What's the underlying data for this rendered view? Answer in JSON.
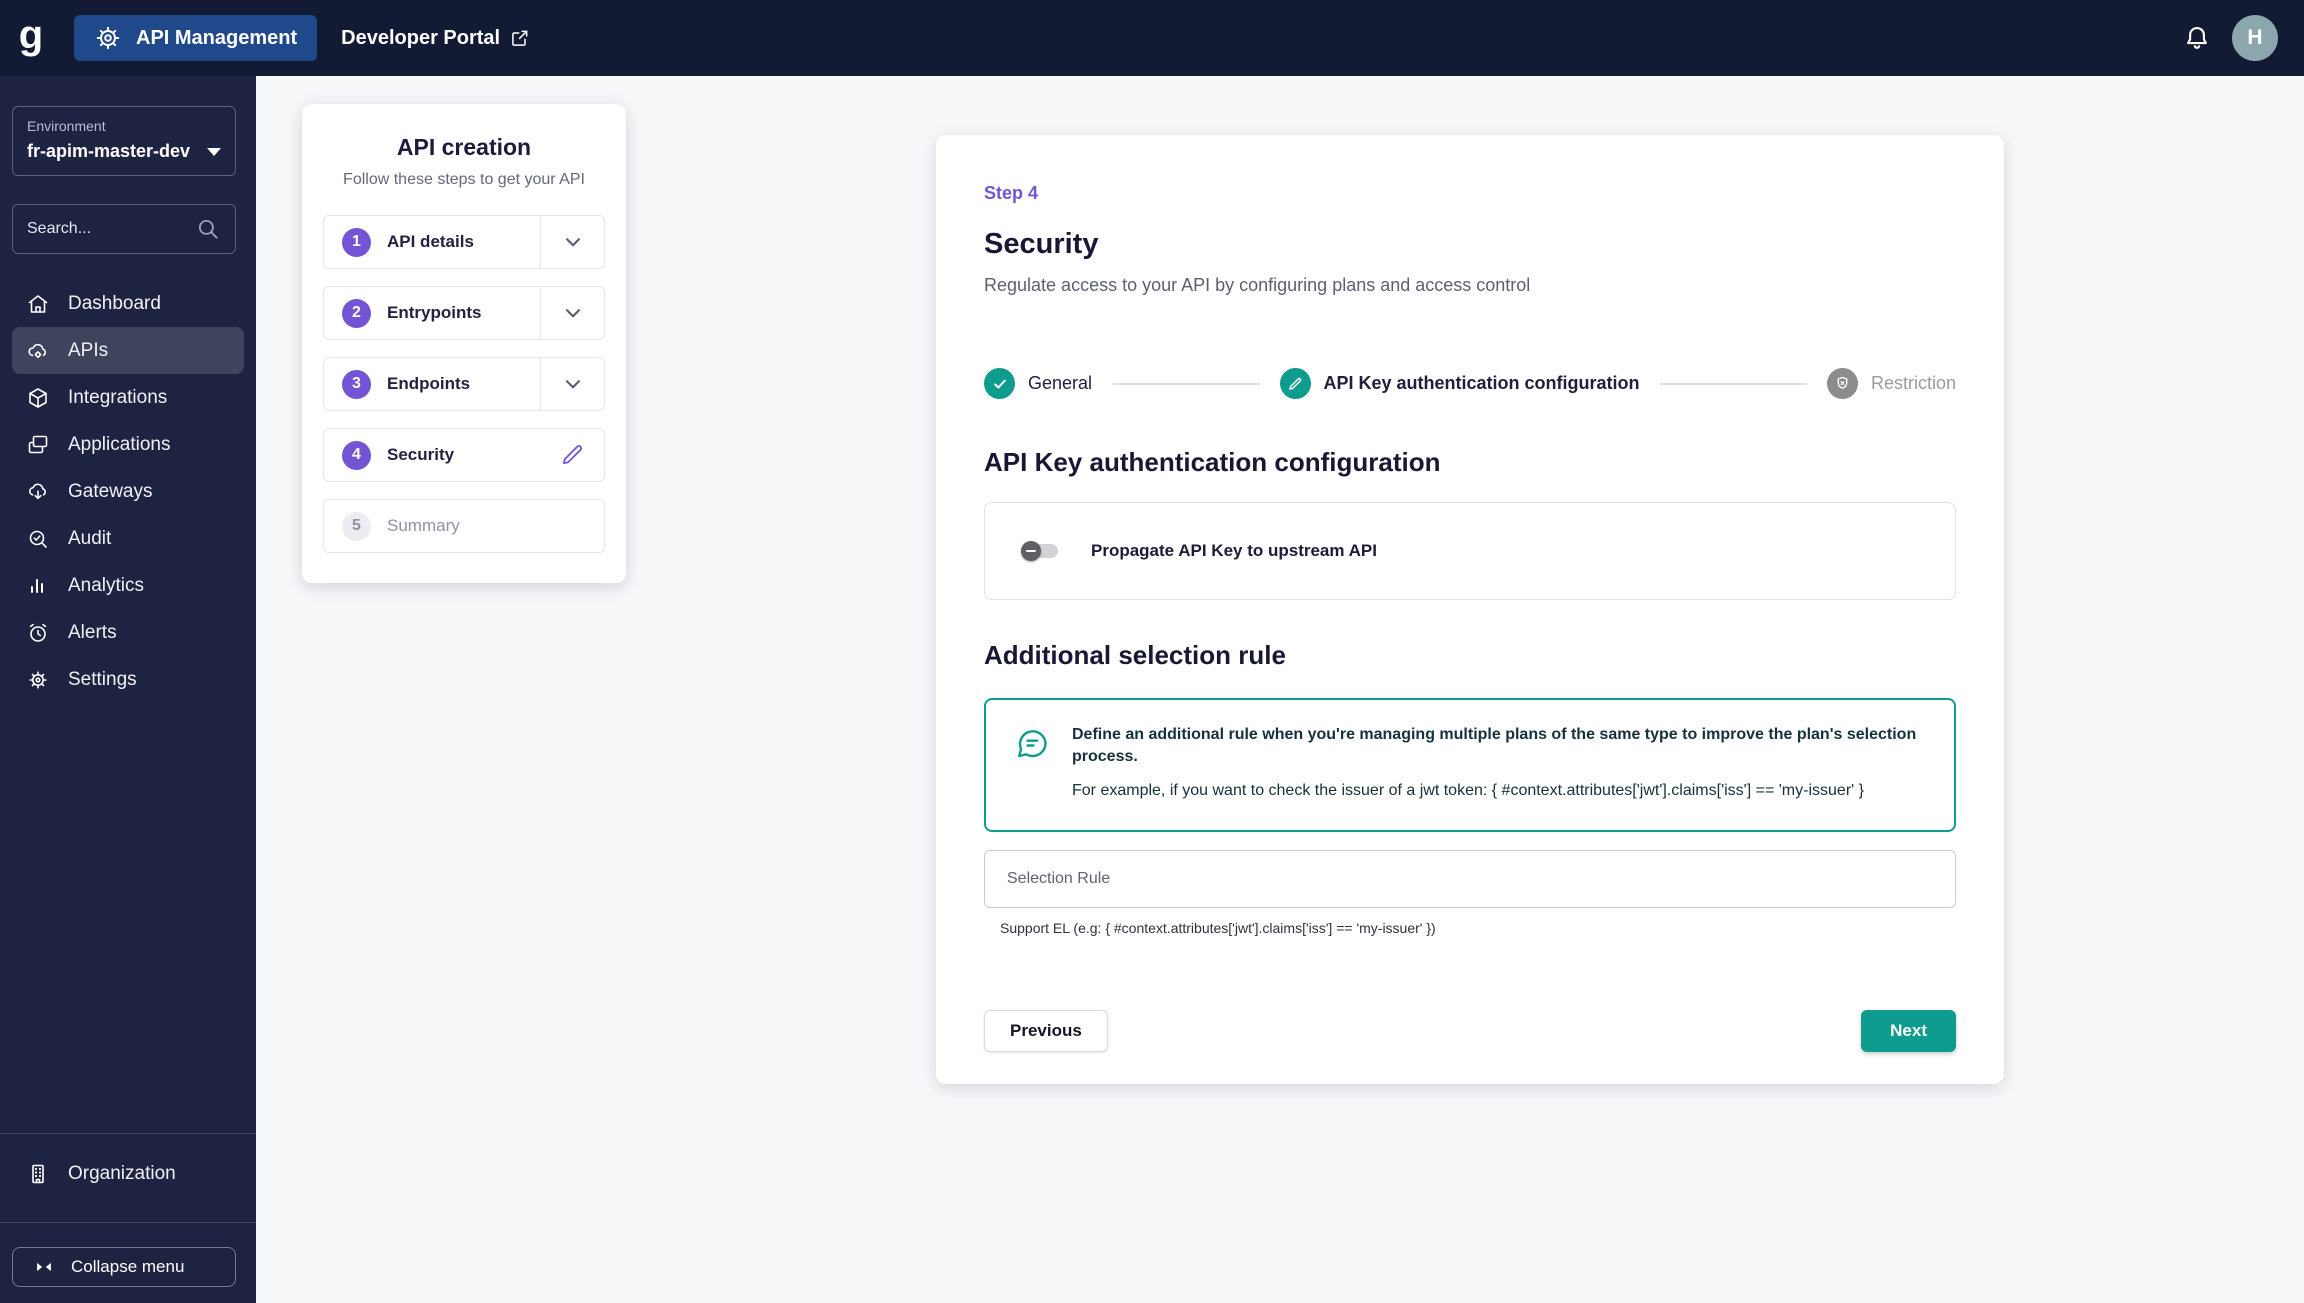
{
  "topbar": {
    "logo_letter": "g",
    "api_management_label": "API Management",
    "developer_portal_label": "Developer Portal",
    "avatar_initial": "H"
  },
  "sidebar": {
    "environment": {
      "label": "Environment",
      "value": "fr-apim-master-dev"
    },
    "search": {
      "placeholder": "Search...",
      "value": ""
    },
    "items": [
      {
        "label": "Dashboard",
        "icon": "home-icon",
        "active": false
      },
      {
        "label": "APIs",
        "icon": "cloud-gear-icon",
        "active": true
      },
      {
        "label": "Integrations",
        "icon": "cube-icon",
        "active": false
      },
      {
        "label": "Applications",
        "icon": "windows-icon",
        "active": false
      },
      {
        "label": "Gateways",
        "icon": "cloud-download-icon",
        "active": false
      },
      {
        "label": "Audit",
        "icon": "search-check-icon",
        "active": false
      },
      {
        "label": "Analytics",
        "icon": "bar-chart-icon",
        "active": false
      },
      {
        "label": "Alerts",
        "icon": "alarm-clock-icon",
        "active": false
      },
      {
        "label": "Settings",
        "icon": "gear-icon",
        "active": false
      }
    ],
    "organization_label": "Organization",
    "collapse_menu_label": "Collapse menu"
  },
  "creation_card": {
    "title": "API creation",
    "subtitle": "Follow these steps to get your API",
    "steps": [
      {
        "number": "1",
        "label": "API details",
        "state": "complete"
      },
      {
        "number": "2",
        "label": "Entrypoints",
        "state": "complete"
      },
      {
        "number": "3",
        "label": "Endpoints",
        "state": "complete"
      },
      {
        "number": "4",
        "label": "Security",
        "state": "current"
      },
      {
        "number": "5",
        "label": "Summary",
        "state": "upcoming"
      }
    ]
  },
  "security_step": {
    "step_label": "Step 4",
    "title": "Security",
    "subtitle": "Regulate access to your API by configuring plans and access control",
    "substeps": [
      {
        "label": "General",
        "state": "done"
      },
      {
        "label": "API Key authentication configuration",
        "state": "current"
      },
      {
        "label": "Restriction",
        "state": "upcoming"
      }
    ],
    "config_section_title": "API Key authentication configuration",
    "propagate_toggle_label": "Propagate API Key to upstream API",
    "propagate_toggle_state": "off",
    "selection_section_title": "Additional selection rule",
    "callout": {
      "line1": "Define an additional rule when you're managing multiple plans of the same type to improve the plan's selection process.",
      "line2": "For example, if you want to check the issuer of a jwt token: { #context.attributes['jwt'].claims['iss'] == 'my-issuer' }"
    },
    "selection_rule": {
      "placeholder": "Selection Rule",
      "value": "",
      "hint": "Support EL (e.g: { #context.attributes['jwt'].claims['iss'] == 'my-issuer' })"
    },
    "previous_label": "Previous",
    "next_label": "Next"
  },
  "colors": {
    "accent_teal": "#0D9C8D",
    "accent_purple": "#7254D4",
    "topbar_button_blue": "#20498B",
    "topbar_bg": "#131A33",
    "sidebar_bg": "#1E2342"
  }
}
